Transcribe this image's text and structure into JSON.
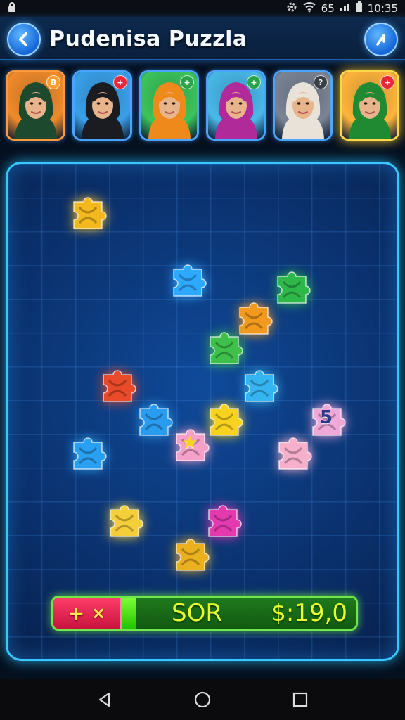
{
  "status_bar": {
    "signal_text": "65",
    "time": "10:35"
  },
  "header": {
    "title": "Pudenisa Puzzla"
  },
  "avatars": [
    {
      "bg": "#f08a2a",
      "scarf": "#1d4a2e",
      "badge": "B",
      "badge_color": "#ff9d2a"
    },
    {
      "bg": "#3aa0e8",
      "scarf": "#1b1b22",
      "badge": "+",
      "badge_color": "#e8283a"
    },
    {
      "bg": "#3cc45a",
      "scarf": "#ee8a1c",
      "badge": "+",
      "badge_color": "#2aa44a"
    },
    {
      "bg": "#49b8e8",
      "scarf": "#b02a9a",
      "badge": "+",
      "badge_color": "#2aa44a"
    },
    {
      "bg": "#7a8494",
      "scarf": "#e8e2d8",
      "badge": "?",
      "badge_color": "#3a3e46"
    },
    {
      "bg": "#ffb43a",
      "scarf": "#1f8a32",
      "badge": "+",
      "badge_color": "#e8283a"
    }
  ],
  "pieces": [
    {
      "name": "piece-gold-1",
      "color": "#f2b81e",
      "glyph": ""
    },
    {
      "name": "piece-blue-1",
      "color": "#2fa8ff",
      "glyph": ""
    },
    {
      "name": "piece-green-ring",
      "color": "#2fb84a",
      "glyph": ""
    },
    {
      "name": "piece-orange",
      "color": "#f29a1e",
      "glyph": ""
    },
    {
      "name": "piece-green",
      "color": "#3ec04a",
      "glyph": ""
    },
    {
      "name": "piece-red",
      "color": "#e84a2a",
      "glyph": ""
    },
    {
      "name": "piece-blue-2",
      "color": "#35b4f2",
      "glyph": ""
    },
    {
      "name": "piece-blue-3",
      "color": "#2a9cf0",
      "glyph": ""
    },
    {
      "name": "piece-yellow",
      "color": "#f7d21e",
      "glyph": ""
    },
    {
      "name": "piece-pink-5",
      "color": "#f0a8d8",
      "glyph": "5"
    },
    {
      "name": "piece-blue-4",
      "color": "#2aa0f2",
      "glyph": ""
    },
    {
      "name": "piece-pink-star",
      "color": "#f4a0c8",
      "glyph": "★"
    },
    {
      "name": "piece-pink-swirl",
      "color": "#f6b0cc",
      "glyph": ""
    },
    {
      "name": "piece-yellow-2",
      "color": "#f5cf3a",
      "glyph": ""
    },
    {
      "name": "piece-magenta",
      "color": "#e43ab0",
      "glyph": ""
    },
    {
      "name": "piece-gold-2",
      "color": "#eab01e",
      "glyph": ""
    }
  ],
  "score": {
    "plus": "+",
    "times": "×",
    "label": "SOR",
    "value": "$:19,0"
  }
}
